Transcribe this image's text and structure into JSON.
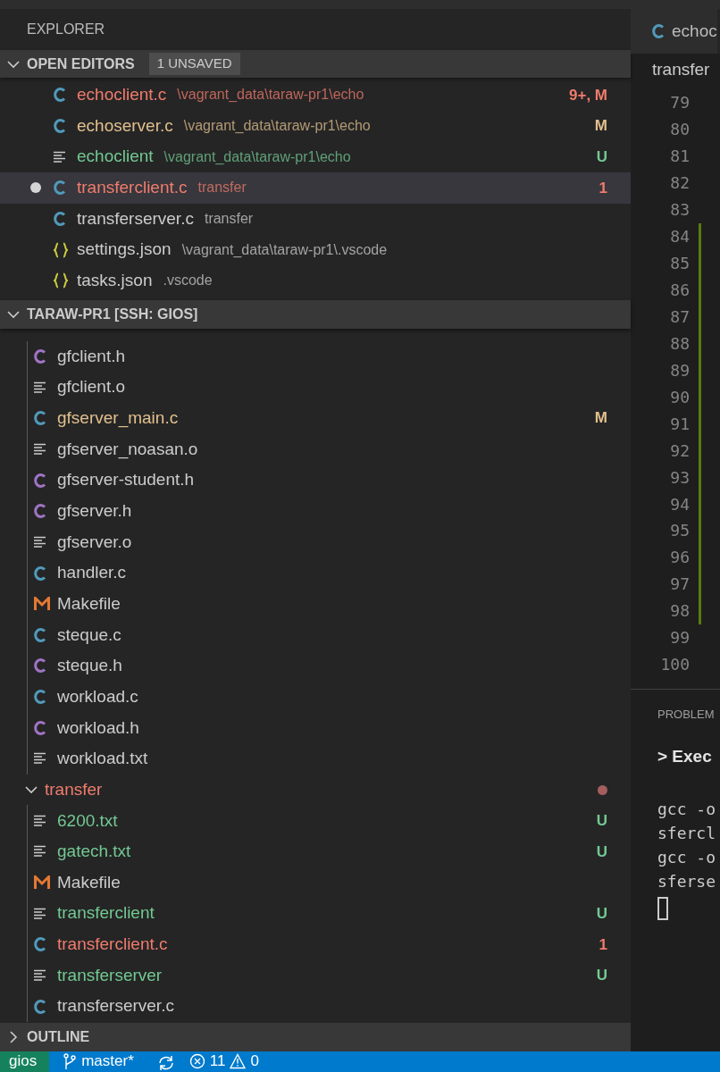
{
  "sidebar": {
    "title": "EXPLORER",
    "open_editors": {
      "label": "OPEN EDITORS",
      "badge": "1 UNSAVED",
      "expanded": true,
      "items": [
        {
          "kind": "c",
          "name": "echoclient.c",
          "path": "\\vagrant_data\\taraw-pr1\\echo",
          "status": "9+, M",
          "color": "#f07c6c",
          "selected": false,
          "unsaved": false
        },
        {
          "kind": "c",
          "name": "echoserver.c",
          "path": "\\vagrant_data\\taraw-pr1\\echo",
          "status": "M",
          "color": "#e2c08d",
          "selected": false,
          "unsaved": false
        },
        {
          "kind": "text",
          "name": "echoclient",
          "path": "\\vagrant_data\\taraw-pr1\\echo",
          "status": "U",
          "color": "#73c991",
          "selected": false,
          "unsaved": false
        },
        {
          "kind": "c",
          "name": "transferclient.c",
          "path": "transfer",
          "status": "1",
          "color": "#f07c6c",
          "selected": true,
          "unsaved": true
        },
        {
          "kind": "c",
          "name": "transferserver.c",
          "path": "transfer",
          "color": "#cccccc",
          "selected": false,
          "unsaved": false
        },
        {
          "kind": "json",
          "name": "settings.json",
          "path": "\\vagrant_data\\taraw-pr1\\.vscode",
          "color": "#cccccc",
          "selected": false,
          "unsaved": false
        },
        {
          "kind": "json",
          "name": "tasks.json",
          "path": ".vscode",
          "color": "#cccccc",
          "selected": false,
          "unsaved": false
        }
      ]
    },
    "folder": {
      "label": "TARAW-PR1 [SSH: GIOS]",
      "expanded": true,
      "tree": [
        {
          "kind": "folder",
          "children": [
            {
              "kind": "h",
              "name": "gfclient.h",
              "color": "#cccccc"
            },
            {
              "kind": "text",
              "name": "gfclient.o",
              "color": "#cccccc"
            },
            {
              "kind": "c",
              "name": "gfserver_main.c",
              "status": "M",
              "color": "#e2c08d"
            },
            {
              "kind": "text",
              "name": "gfserver_noasan.o",
              "color": "#cccccc"
            },
            {
              "kind": "h",
              "name": "gfserver-student.h",
              "color": "#cccccc"
            },
            {
              "kind": "h",
              "name": "gfserver.h",
              "color": "#cccccc"
            },
            {
              "kind": "text",
              "name": "gfserver.o",
              "color": "#cccccc"
            },
            {
              "kind": "c",
              "name": "handler.c",
              "color": "#cccccc"
            },
            {
              "kind": "make",
              "name": "Makefile",
              "color": "#cccccc"
            },
            {
              "kind": "c",
              "name": "steque.c",
              "color": "#cccccc"
            },
            {
              "kind": "h",
              "name": "steque.h",
              "color": "#cccccc"
            },
            {
              "kind": "c",
              "name": "workload.c",
              "color": "#cccccc"
            },
            {
              "kind": "h",
              "name": "workload.h",
              "color": "#cccccc"
            },
            {
              "kind": "text",
              "name": "workload.txt",
              "color": "#cccccc"
            }
          ]
        },
        {
          "kind": "folder",
          "name": "transfer",
          "expanded": true,
          "color": "#f07c6c",
          "has_problems": true,
          "children": [
            {
              "kind": "text",
              "name": "6200.txt",
              "status": "U",
              "color": "#73c991"
            },
            {
              "kind": "text",
              "name": "gatech.txt",
              "status": "U",
              "color": "#73c991"
            },
            {
              "kind": "make",
              "name": "Makefile",
              "color": "#cccccc"
            },
            {
              "kind": "text",
              "name": "transferclient",
              "status": "U",
              "color": "#73c991"
            },
            {
              "kind": "c",
              "name": "transferclient.c",
              "status": "1",
              "color": "#f07c6c"
            },
            {
              "kind": "text",
              "name": "transferserver",
              "status": "U",
              "color": "#73c991"
            },
            {
              "kind": "c",
              "name": "transferserver.c",
              "color": "#cccccc"
            }
          ]
        }
      ]
    },
    "outline": {
      "label": "OUTLINE",
      "expanded": false
    }
  },
  "editor": {
    "tab": "echoc",
    "breadcrumb": "transfer",
    "lines": [
      {
        "number": "79",
        "changed": false
      },
      {
        "number": "80",
        "changed": false
      },
      {
        "number": "81",
        "changed": false
      },
      {
        "number": "82",
        "changed": false
      },
      {
        "number": "83",
        "changed": false
      },
      {
        "number": "84",
        "changed": true
      },
      {
        "number": "85",
        "changed": true
      },
      {
        "number": "86",
        "changed": true
      },
      {
        "number": "87",
        "changed": true
      },
      {
        "number": "88",
        "changed": true
      },
      {
        "number": "89",
        "changed": true
      },
      {
        "number": "90",
        "changed": true
      },
      {
        "number": "91",
        "changed": true
      },
      {
        "number": "92",
        "changed": true
      },
      {
        "number": "93",
        "changed": true
      },
      {
        "number": "94",
        "changed": true
      },
      {
        "number": "95",
        "changed": true
      },
      {
        "number": "96",
        "changed": true
      },
      {
        "number": "97",
        "changed": true
      },
      {
        "number": "98",
        "changed": true
      },
      {
        "number": "99",
        "changed": false
      },
      {
        "number": "100",
        "changed": false
      }
    ]
  },
  "panel": {
    "tab": "PROBLEM",
    "task": "> Exec",
    "terminal": [
      "gcc -o",
      "sfercl",
      "gcc -o",
      "sferse"
    ]
  },
  "status_bar": {
    "remote": "gios",
    "branch": "master*",
    "errors": "11",
    "warnings": "0"
  }
}
